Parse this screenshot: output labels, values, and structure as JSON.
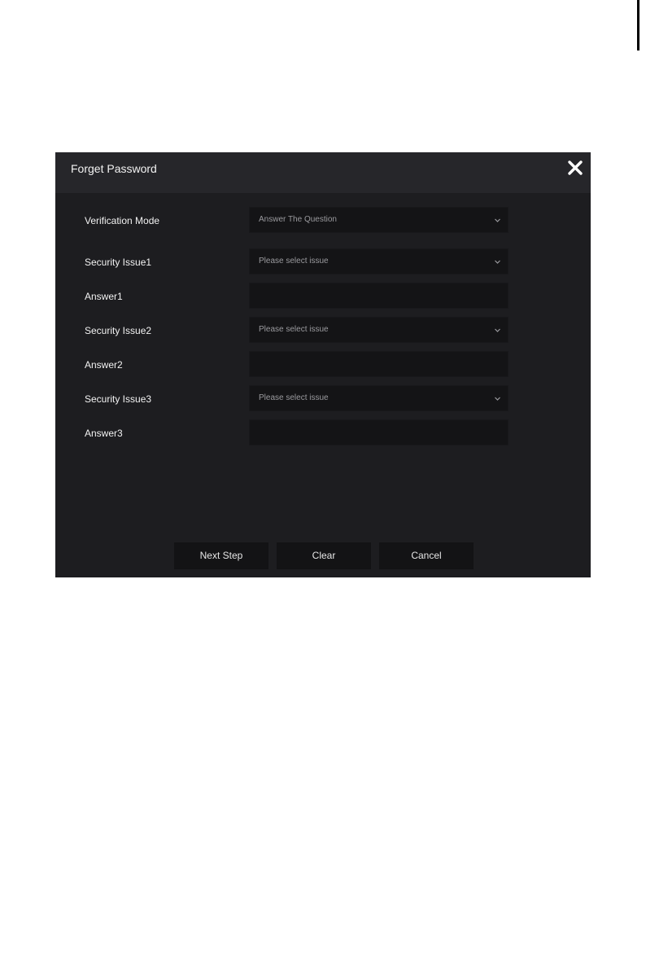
{
  "dialog": {
    "title": "Forget Password",
    "rows": [
      {
        "label": "Verification Mode",
        "value": "Answer The Question",
        "kind": "select"
      },
      {
        "label": "Security Issue1",
        "value": "Please select issue",
        "kind": "select"
      },
      {
        "label": "Answer1",
        "value": "",
        "kind": "input"
      },
      {
        "label": "Security Issue2",
        "value": "Please select issue",
        "kind": "select"
      },
      {
        "label": "Answer2",
        "value": "",
        "kind": "input"
      },
      {
        "label": "Security Issue3",
        "value": "Please select issue",
        "kind": "select"
      },
      {
        "label": "Answer3",
        "value": "",
        "kind": "input"
      }
    ],
    "buttons": {
      "next_label": "Next Step",
      "clear_label": "Clear",
      "cancel_label": "Cancel"
    }
  },
  "icons": {
    "close": "close-icon",
    "dropdown": "chevron-down-icon"
  },
  "colors": {
    "dialog_background": "#1d1d20",
    "header_background": "#26262a",
    "field_background": "#141416",
    "text_primary": "#f2f2f2",
    "text_secondary": "#9a9a9e"
  }
}
